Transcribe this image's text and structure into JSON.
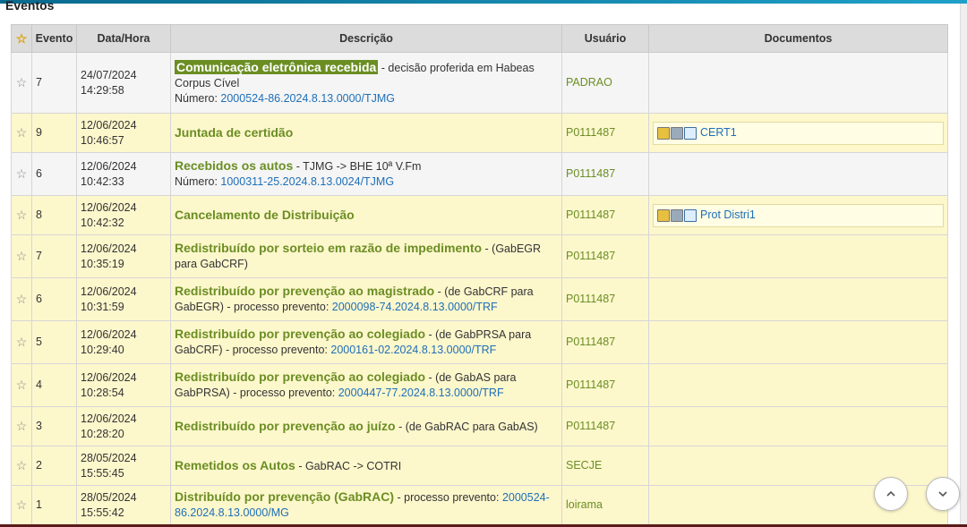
{
  "section": {
    "title": "Eventos"
  },
  "table": {
    "headers": {
      "star": "☆",
      "evento": "Evento",
      "data_hora": "Data/Hora",
      "descricao": "Descrição",
      "usuario": "Usuário",
      "documentos": "Documentos"
    },
    "rows": [
      {
        "evento": "7",
        "data": "24/07/2024",
        "hora": "14:29:58",
        "title": "Comunicação eletrônica recebida",
        "rest": " - decisão proferida em Habeas Corpus Cível",
        "line2_label": "Número: ",
        "line2_link": "2000524-86.2024.8.13.0000/TJMG",
        "usuario": "PADRAO",
        "doc": ""
      },
      {
        "evento": "9",
        "data": "12/06/2024",
        "hora": "10:46:57",
        "title": "Juntada de certidão",
        "rest": "",
        "line2_label": "",
        "line2_link": "",
        "usuario": "P0111487",
        "doc": "CERT1"
      },
      {
        "evento": "6",
        "data": "12/06/2024",
        "hora": "10:42:33",
        "title": "Recebidos os autos",
        "rest": " - TJMG -> BHE 10ª V.Fm",
        "line2_label": "Número: ",
        "line2_link": "1000311-25.2024.8.13.0024/TJMG",
        "usuario": "P0111487",
        "doc": ""
      },
      {
        "evento": "8",
        "data": "12/06/2024",
        "hora": "10:42:32",
        "title": "Cancelamento de Distribuição",
        "rest": "",
        "line2_label": "",
        "line2_link": "",
        "usuario": "P0111487",
        "doc": "Prot Distri1"
      },
      {
        "evento": "7",
        "data": "12/06/2024",
        "hora": "10:35:19",
        "title": "Redistribuído por sorteio em razão de impedimento",
        "rest": " - (GabEGR para GabCRF)",
        "line2_label": "",
        "line2_link": "",
        "usuario": "P0111487",
        "doc": ""
      },
      {
        "evento": "6",
        "data": "12/06/2024",
        "hora": "10:31:59",
        "title": "Redistribuído por prevenção ao magistrado",
        "rest": " - (de GabCRF para GabEGR) - processo prevento: ",
        "line2_label": "",
        "line2_link": "2000098-74.2024.8.13.0000/TRF",
        "usuario": "P0111487",
        "doc": ""
      },
      {
        "evento": "5",
        "data": "12/06/2024",
        "hora": "10:29:40",
        "title": "Redistribuído por prevenção ao colegiado",
        "rest": " - (de GabPRSA para GabCRF) - processo prevento: ",
        "line2_label": "",
        "line2_link": "2000161-02.2024.8.13.0000/TRF",
        "usuario": "P0111487",
        "doc": ""
      },
      {
        "evento": "4",
        "data": "12/06/2024",
        "hora": "10:28:54",
        "title": "Redistribuído por prevenção ao colegiado",
        "rest": " - (de GabAS para GabPRSA) - processo prevento: ",
        "line2_label": "",
        "line2_link": "2000447-77.2024.8.13.0000/TRF",
        "usuario": "P0111487",
        "doc": ""
      },
      {
        "evento": "3",
        "data": "12/06/2024",
        "hora": "10:28:20",
        "title": "Redistribuído por prevenção ao juízo",
        "rest": " - (de GabRAC para GabAS)",
        "line2_label": "",
        "line2_link": "",
        "usuario": "P0111487",
        "doc": ""
      },
      {
        "evento": "2",
        "data": "28/05/2024",
        "hora": "15:55:45",
        "title": "Remetidos os Autos",
        "rest": " - GabRAC -> COTRI",
        "line2_label": "",
        "line2_link": "",
        "usuario": "SECJE",
        "doc": ""
      },
      {
        "evento": "1",
        "data": "28/05/2024",
        "hora": "15:55:42",
        "title": "Distribuído por prevenção (GabRAC)",
        "rest": " - processo prevento: ",
        "line2_label": "",
        "line2_link": "2000524-86.2024.8.13.0000/MG",
        "usuario": "loirama",
        "doc": ""
      }
    ]
  },
  "scroll": {
    "up_icon": "chevron-up-icon",
    "down_icon": "chevron-down-icon"
  }
}
